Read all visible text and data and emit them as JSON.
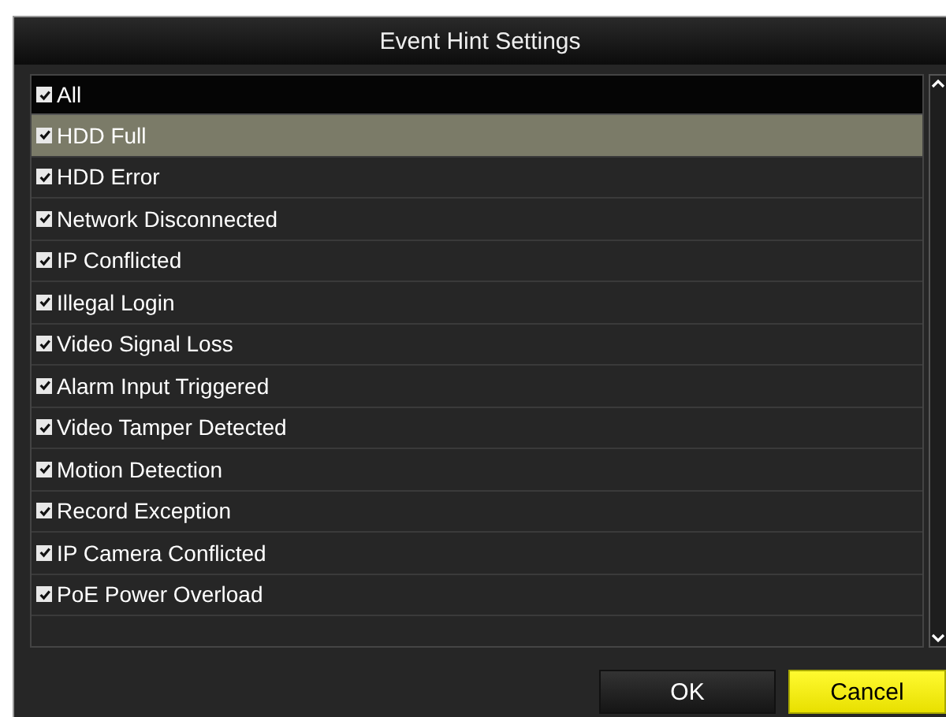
{
  "dialog": {
    "title": "Event Hint Settings"
  },
  "header": {
    "label": "All",
    "checked": true
  },
  "items": [
    {
      "label": "HDD Full",
      "checked": true,
      "selected": true
    },
    {
      "label": "HDD Error",
      "checked": true,
      "selected": false
    },
    {
      "label": "Network Disconnected",
      "checked": true,
      "selected": false
    },
    {
      "label": "IP Conflicted",
      "checked": true,
      "selected": false
    },
    {
      "label": "Illegal Login",
      "checked": true,
      "selected": false
    },
    {
      "label": "Video Signal Loss",
      "checked": true,
      "selected": false
    },
    {
      "label": "Alarm Input Triggered",
      "checked": true,
      "selected": false
    },
    {
      "label": "Video Tamper Detected",
      "checked": true,
      "selected": false
    },
    {
      "label": "Motion Detection",
      "checked": true,
      "selected": false
    },
    {
      "label": "Record Exception",
      "checked": true,
      "selected": false
    },
    {
      "label": "IP Camera Conflicted",
      "checked": true,
      "selected": false
    },
    {
      "label": "PoE Power Overload",
      "checked": true,
      "selected": false
    }
  ],
  "buttons": [
    {
      "label": "OK",
      "kind": "normal"
    },
    {
      "label": "Cancel",
      "kind": "primary"
    }
  ]
}
